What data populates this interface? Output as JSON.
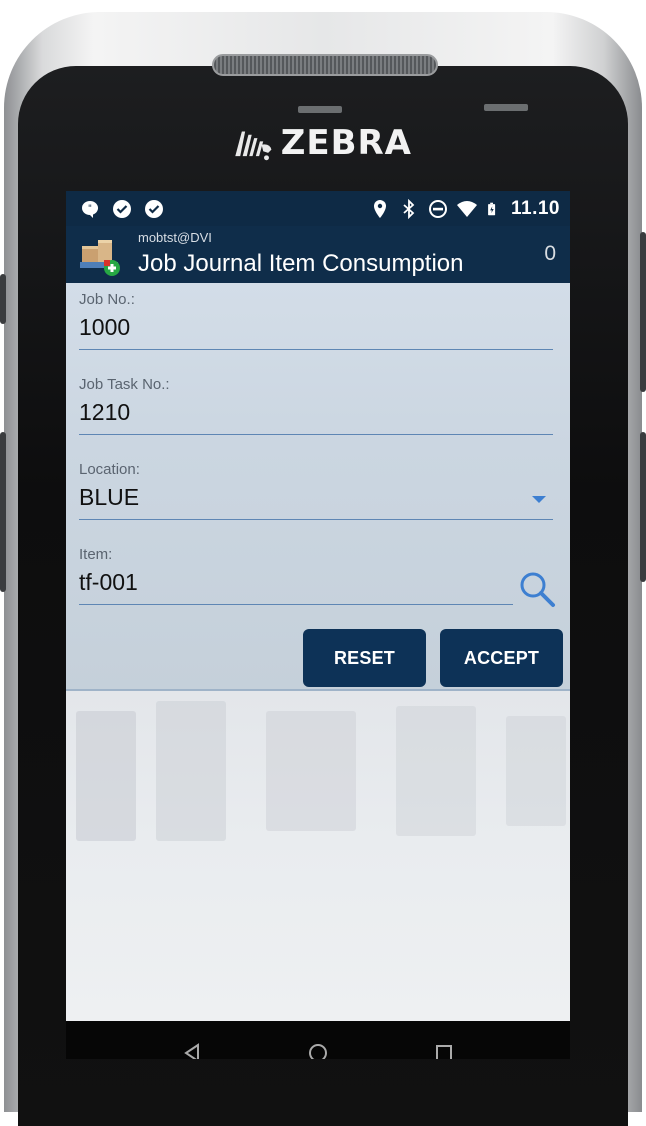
{
  "device": {
    "brand": "ZEBRA"
  },
  "statusbar": {
    "left_icons": [
      "chat-bubble-icon",
      "check-circle-icon",
      "check-circle-icon"
    ],
    "right_icons": [
      "location-pin-icon",
      "bluetooth-icon",
      "do-not-disturb-icon",
      "wifi-icon",
      "battery-charging-icon"
    ],
    "time": "11.10"
  },
  "appbar": {
    "user": "mobtst@DVI",
    "title": "Job Journal Item Consumption",
    "count": "0"
  },
  "form": {
    "job_no": {
      "label": "Job No.:",
      "value": "1000"
    },
    "job_task_no": {
      "label": "Job Task No.:",
      "value": "1210"
    },
    "location": {
      "label": "Location:",
      "value": "BLUE"
    },
    "item": {
      "label": "Item:",
      "value": "tf-001"
    }
  },
  "buttons": {
    "reset": "RESET",
    "accept": "ACCEPT"
  },
  "colors": {
    "primary": "#0d3257",
    "accent": "#3d7fd1",
    "statusbar": "#0e2a45"
  }
}
